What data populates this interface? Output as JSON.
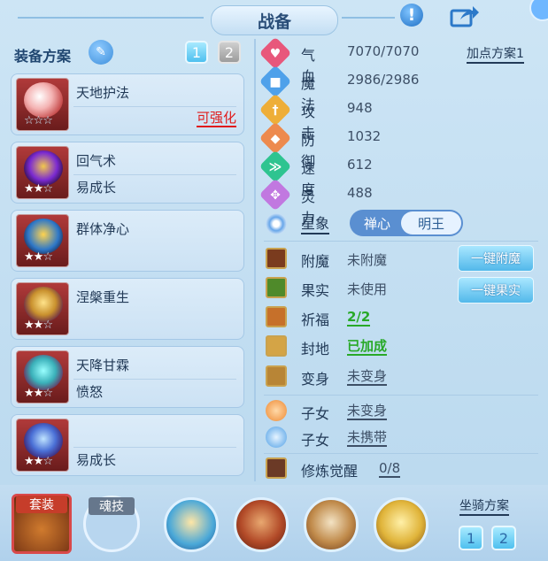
{
  "header": {
    "title": "战备",
    "hint_icon": "exclamation-icon",
    "share_icon": "share-icon"
  },
  "left": {
    "scheme_label": "装备方案",
    "pages": [
      "1",
      "2"
    ],
    "skills": [
      {
        "name": "天地护法",
        "sub": "",
        "action": "可强化",
        "stars": 0
      },
      {
        "name": "回气术",
        "sub": "易成长",
        "action": "",
        "stars": 2
      },
      {
        "name": "群体净心",
        "sub": "",
        "action": "",
        "stars": 2
      },
      {
        "name": "涅槃重生",
        "sub": "",
        "action": "",
        "stars": 2
      },
      {
        "name": "天降甘霖",
        "sub": "愤怒",
        "action": "",
        "stars": 2
      },
      {
        "name": "",
        "sub": "易成长",
        "action": "",
        "stars": 2
      }
    ]
  },
  "stats": {
    "plan_link": "加点方案1",
    "rows": [
      {
        "name": "气血",
        "value": "7070/7070",
        "color": "#e8577b",
        "icon": "heart-icon",
        "glyph": "♥"
      },
      {
        "name": "魔法",
        "value": "2986/2986",
        "color": "#4fa1ea",
        "icon": "mana-icon",
        "glyph": "■"
      },
      {
        "name": "攻击",
        "value": "948",
        "color": "#eeae38",
        "icon": "sword-icon",
        "glyph": "†"
      },
      {
        "name": "防御",
        "value": "1032",
        "color": "#ed8a4e",
        "icon": "shield-icon",
        "glyph": "◆"
      },
      {
        "name": "速度",
        "value": "612",
        "color": "#2ec490",
        "icon": "speed-icon",
        "glyph": "≫"
      },
      {
        "name": "灵力",
        "value": "488",
        "color": "#c178e0",
        "icon": "spirit-icon",
        "glyph": "✥"
      }
    ],
    "astro_label": "星象",
    "astro_options": [
      "禅心",
      "明王"
    ]
  },
  "extras": {
    "rows": [
      {
        "name": "附魔",
        "value": "未附魔",
        "style": "plain",
        "icon": "enchant-icon"
      },
      {
        "name": "果实",
        "value": "未使用",
        "style": "plain",
        "icon": "fruit-icon"
      },
      {
        "name": "祈福",
        "value": "2/2",
        "style": "green",
        "icon": "blessing-icon"
      },
      {
        "name": "封地",
        "value": "已加成",
        "style": "green",
        "icon": "fief-icon"
      },
      {
        "name": "变身",
        "value": "未变身",
        "style": "underline",
        "icon": "transform-icon"
      },
      {
        "name": "子女",
        "value": "未变身",
        "style": "underline",
        "icon": "child-icon"
      },
      {
        "name": "子女",
        "value": "未携带",
        "style": "underline",
        "icon": "paw-icon"
      },
      {
        "name": "修炼觉醒",
        "value": "0/8",
        "style": "underline",
        "icon": "cultivation-icon"
      }
    ],
    "enchant_button": "一键附魔",
    "fruit_button": "一键果实"
  },
  "bottom": {
    "suit_label": "套装",
    "soul_label": "魂技",
    "mount_scheme": "坐骑方案",
    "mount_pages": [
      "1",
      "2"
    ]
  }
}
